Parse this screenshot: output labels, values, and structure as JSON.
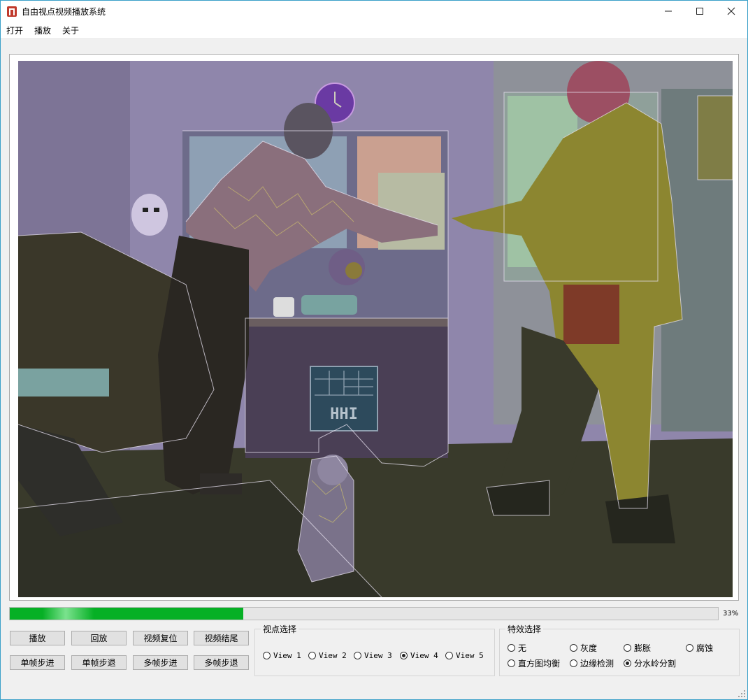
{
  "window": {
    "title": "自由视点视频播放系统",
    "accent_border": "#3aa0c8",
    "controls": {
      "minimize_icon": "minimize-icon",
      "maximize_icon": "maximize-icon",
      "close_icon": "close-icon"
    }
  },
  "menu": {
    "items": [
      "打开",
      "播放",
      "关于"
    ]
  },
  "video": {
    "effect_overlay": "watershed-segmentation",
    "sign_text": "HHI"
  },
  "progress": {
    "percent": 33,
    "label": "33%",
    "color": "#06b025"
  },
  "buttons": {
    "row1": [
      "播放",
      "回放",
      "视频复位",
      "视频结尾"
    ],
    "row2": [
      "单帧步进",
      "单帧步退",
      "多帧步进",
      "多帧步退"
    ]
  },
  "viewpoint": {
    "title": "视点选择",
    "options": [
      "View 1",
      "View 2",
      "View 3",
      "View 4",
      "View 5"
    ],
    "selected": "View 4"
  },
  "effects": {
    "title": "特效选择",
    "options": [
      "无",
      "灰度",
      "膨胀",
      "腐蚀",
      "直方图均衡",
      "边缘检测",
      "分水岭分割"
    ],
    "selected": "分水岭分割"
  }
}
